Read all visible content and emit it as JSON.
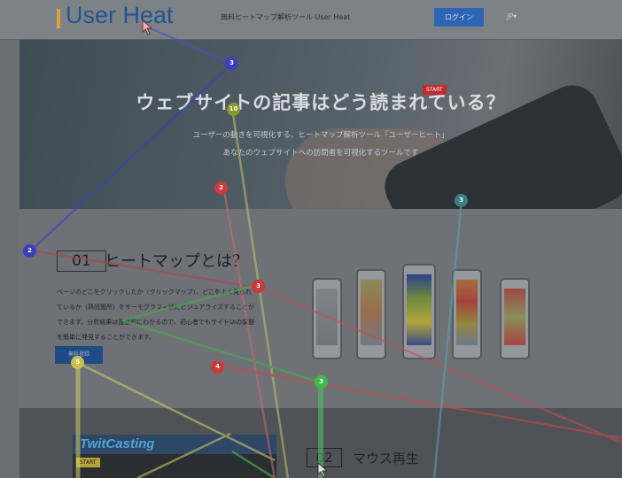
{
  "header": {
    "logo": "User Heat",
    "tagline": "無料ヒートマップ解析ツール User Heat",
    "login_label": "ログイン",
    "lang_label": "JP▾"
  },
  "hero": {
    "title": "ウェブサイトの記事はどう読まれている？",
    "subtitle_line1": "ユーザーの動きを可視化する、ヒートマップ解析ツール「ユーザーヒート」",
    "subtitle_line2": "あなたのウェブサイトへの訪問者を可視化するツールです"
  },
  "section1": {
    "number": "01",
    "title": "ヒートマップとは？",
    "body_lines": [
      "ページのどこをクリックしたか（クリックマップ）、どこをよく見られ",
      "ているか（熟読箇所）をサーモグラフィ状にビジュアライズすることが",
      "できます。分析結果は直感的にわかるので、初心者でもサイトUIの課題",
      "を簡単に発見することができます。"
    ],
    "register_label": "無料登録"
  },
  "section2": {
    "number": "02",
    "title": "マウス再生",
    "twitcasting_logo": "TwitCasting",
    "twitcasting_start": "START"
  },
  "overlay": {
    "start_label": "START",
    "markers": [
      "3",
      "10",
      "2",
      "2",
      "3",
      "3",
      "4",
      "3",
      "5"
    ],
    "colors": {
      "blue": "#3b3fbd",
      "olive": "#8a9a2a",
      "red": "#c9393e",
      "teal": "#3a7f86",
      "green": "#3dbb4a",
      "yellow": "#c9c24a",
      "start": "#c4282e"
    }
  }
}
